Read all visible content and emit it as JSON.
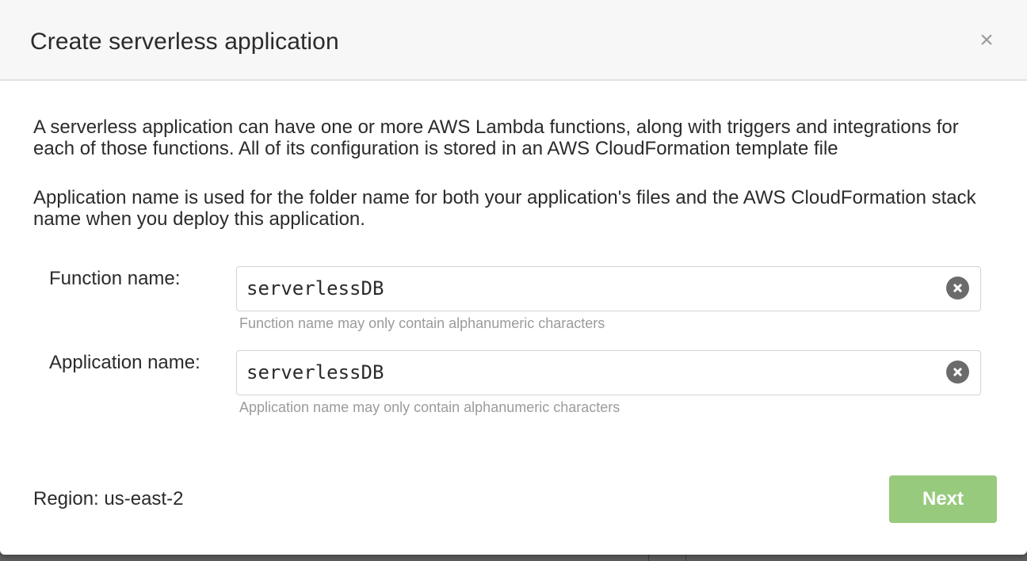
{
  "dialog": {
    "title": "Create serverless application",
    "close_glyph": "×",
    "close_icon": "close-icon",
    "description_1": "A serverless application can have one or more AWS Lambda functions, along with triggers and integrations for each of those functions. All of its configuration is stored in an AWS CloudFormation template file",
    "description_2": "Application name is used for the folder name for both your application's files and the AWS CloudFormation stack name when you deploy this application."
  },
  "form": {
    "function_name": {
      "label": "Function name:",
      "value": "serverlessDB",
      "hint": "Function name may only contain alphanumeric characters",
      "clear_icon": "clear-icon"
    },
    "application_name": {
      "label": "Application name:",
      "value": "serverlessDB",
      "hint": "Application name may only contain alphanumeric characters",
      "clear_icon": "clear-icon"
    }
  },
  "footer": {
    "region": "Region: us-east-2",
    "next_label": "Next"
  },
  "colors": {
    "accent_button": "#97ca7d",
    "header_bg": "#f7f7f7",
    "hint_text": "#9b9b9b"
  }
}
